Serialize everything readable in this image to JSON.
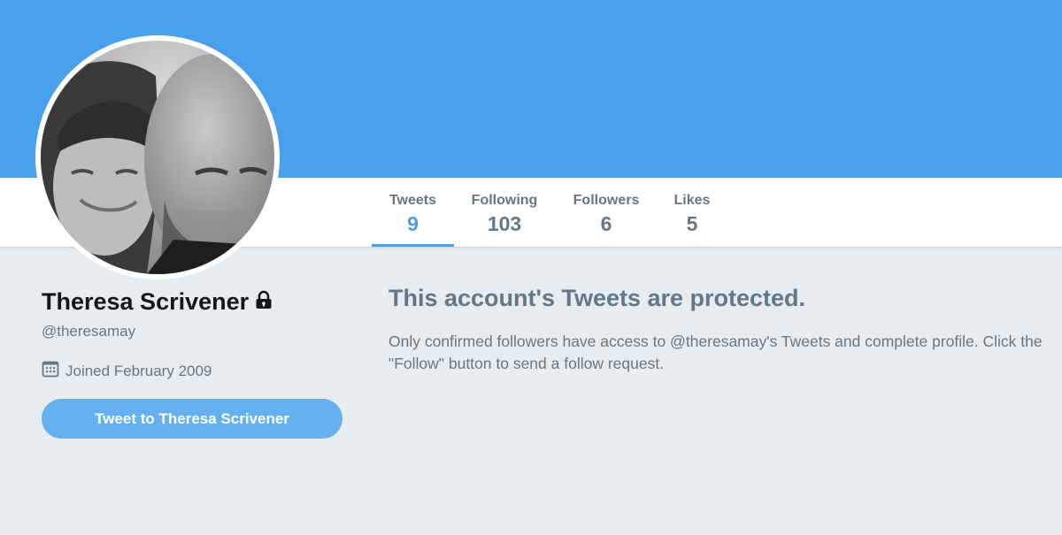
{
  "profile": {
    "name": "Theresa Scrivener",
    "handle": "@theresamay",
    "joined": "Joined February 2009",
    "tweet_button": "Tweet to Theresa Scrivener"
  },
  "stats": [
    {
      "label": "Tweets",
      "value": "9",
      "active": true
    },
    {
      "label": "Following",
      "value": "103",
      "active": false
    },
    {
      "label": "Followers",
      "value": "6",
      "active": false
    },
    {
      "label": "Likes",
      "value": "5",
      "active": false
    }
  ],
  "protected": {
    "title": "This account's Tweets are protected.",
    "body": "Only confirmed followers have access to @theresamay's Tweets and complete profile. Click the \"Follow\" button to send a follow request."
  },
  "colors": {
    "banner": "#4a9fea",
    "accent": "#4a9fea",
    "background": "#e6ecf0",
    "muted_text": "#657786",
    "button": "#65b0ef"
  },
  "icons": {
    "lock": "lock-icon",
    "calendar": "calendar-icon"
  }
}
